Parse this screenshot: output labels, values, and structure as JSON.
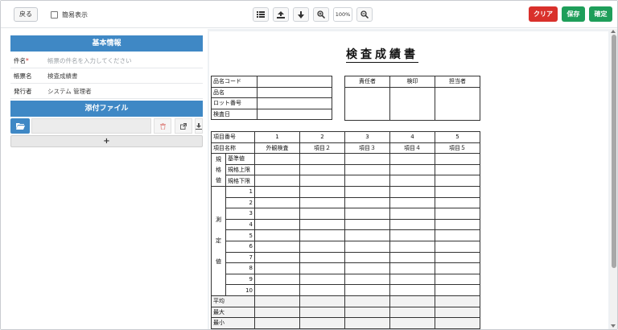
{
  "toolbar": {
    "back_label": "戻る",
    "simple_view_label": "簡易表示",
    "simple_view_checked": false,
    "zoom_label": "100%",
    "clear_label": "クリア",
    "save_label": "保存",
    "confirm_label": "確定",
    "colors": {
      "clear": "#d9302b",
      "save": "#1e9e5a",
      "confirm": "#1e9e5a",
      "header": "#3f88c5"
    }
  },
  "basic_info": {
    "header": "基本情報",
    "subject_label": "件名",
    "subject_required_mark": "*",
    "subject_placeholder": "帳票の件名を入力してください",
    "form_name_label": "帳票名",
    "form_name_value": "検査成績書",
    "issuer_label": "発行者",
    "issuer_value": "システム 管理者"
  },
  "attachments": {
    "header": "添付ファイル",
    "add_label": "+"
  },
  "document": {
    "title": "検査成績書",
    "info_labels": [
      "品名コード",
      "品名",
      "ロット番号",
      "検査日"
    ],
    "stamp_headers": [
      "責任者",
      "検印",
      "担当者"
    ],
    "item_no_label": "項目番号",
    "item_name_label": "項目名称",
    "item_numbers": [
      "1",
      "2",
      "3",
      "4",
      "5"
    ],
    "item_names": [
      "外観検査",
      "項目２",
      "項目３",
      "項目４",
      "項目５"
    ],
    "spec_group_label": [
      "規",
      "格",
      "値"
    ],
    "spec_rows": [
      "基準値",
      "規格上限",
      "規格下限"
    ],
    "measure_group_label": [
      "測",
      "定",
      "値"
    ],
    "measure_numbers": [
      "1",
      "2",
      "3",
      "4",
      "5",
      "6",
      "7",
      "8",
      "9",
      "10"
    ],
    "summary_rows": [
      "平均",
      "最大",
      "最小"
    ]
  }
}
